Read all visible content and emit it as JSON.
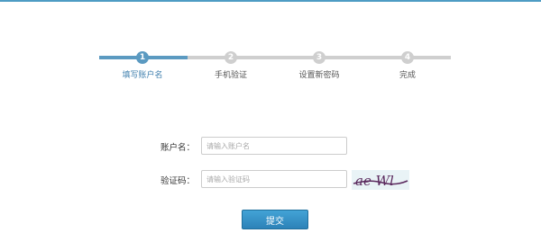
{
  "steps": [
    {
      "number": "1",
      "label": "填写账户名",
      "active": true
    },
    {
      "number": "2",
      "label": "手机验证",
      "active": false
    },
    {
      "number": "3",
      "label": "设置新密码",
      "active": false
    },
    {
      "number": "4",
      "label": "完成",
      "active": false
    }
  ],
  "form": {
    "account_label": "账户名：",
    "account_placeholder": "请输入账户名",
    "captcha_label": "验证码：",
    "captcha_placeholder": "请输入验证码",
    "captcha_text": "ae Wl",
    "submit_label": "提交"
  },
  "colors": {
    "accent": "#5b9ac1",
    "inactive": "#cfcfcf",
    "button": "#2c82b8",
    "captcha_ink": "#5b2a5e"
  }
}
